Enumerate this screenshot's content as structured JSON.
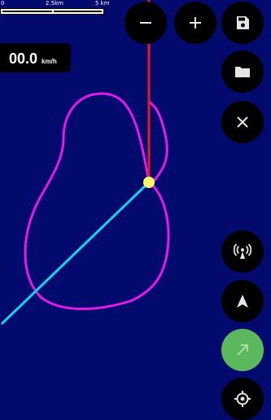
{
  "scale": {
    "ticks": [
      "0",
      "2.5km",
      "5 km"
    ]
  },
  "speed": {
    "value": "00.0",
    "unit": "km/h"
  },
  "colors": {
    "background": "#020a6e",
    "route_outline": "#e619e6",
    "heading_line": "#e8191e",
    "bearing_line": "#13d3f0",
    "position_marker": "#ffff66",
    "direction_button": "#5cb85c"
  },
  "icons": {
    "zoom_out": "minus-icon",
    "zoom_in": "plus-icon",
    "save": "floppy-disk-icon",
    "open": "folder-icon",
    "close": "close-icon",
    "antenna": "antenna-icon",
    "navigate": "navigation-arrow-icon",
    "direction": "arrow-up-right-icon",
    "locate": "crosshair-icon"
  }
}
